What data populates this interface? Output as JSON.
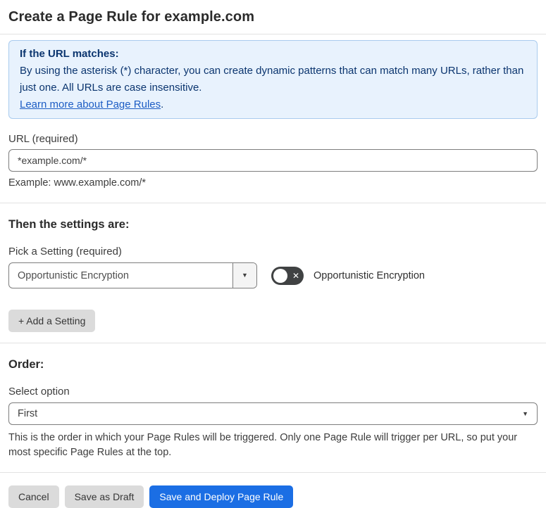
{
  "page": {
    "title": "Create a Page Rule for example.com"
  },
  "info_box": {
    "heading": "If the URL matches:",
    "body": "By using the asterisk (*) character, you can create dynamic patterns that can match many URLs, rather than just one. All URLs are case insensitive.",
    "link": "Learn more about Page Rules",
    "link_suffix": "."
  },
  "url_field": {
    "label": "URL (required)",
    "value": "*example.com/*",
    "helper": "Example: www.example.com/*"
  },
  "settings_section": {
    "heading": "Then the settings are:",
    "pick_label": "Pick a Setting (required)",
    "selected_setting": "Opportunistic Encryption",
    "toggle_label": "Opportunistic Encryption",
    "toggle_state": "off",
    "add_button": "+ Add a Setting"
  },
  "order_section": {
    "heading": "Order:",
    "select_label": "Select option",
    "selected_option": "First",
    "helper": "This is the order in which your Page Rules will be triggered. Only one Page Rule will trigger per URL, so put your most specific Page Rules at the top."
  },
  "actions": {
    "cancel": "Cancel",
    "save_draft": "Save as Draft",
    "save_deploy": "Save and Deploy Page Rule"
  },
  "colors": {
    "info_bg": "#e8f2fd",
    "info_border": "#a9cbee",
    "info_text": "#0b356f",
    "link": "#1d5dc4",
    "primary_button": "#1b6ee4",
    "gray_button": "#dbdbdb",
    "toggle_off_bg": "#404243"
  },
  "icons": {
    "dropdown_arrow": "▼",
    "toggle_x": "✕"
  }
}
